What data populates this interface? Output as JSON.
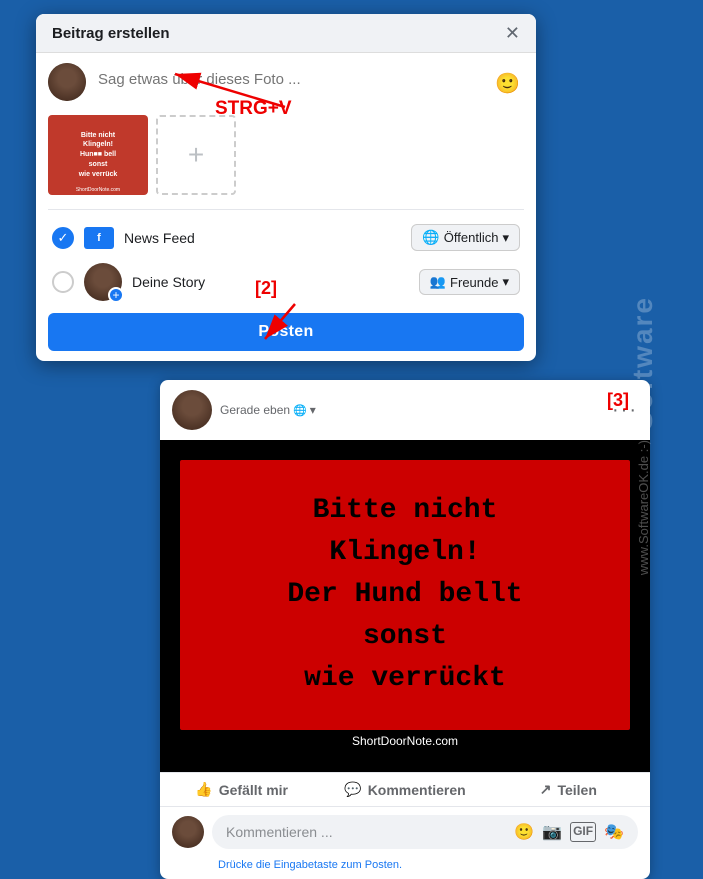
{
  "dialog": {
    "title": "Beitrag erstellen",
    "close_label": "✕",
    "input_placeholder": "Sag etwas über dieses Foto ...",
    "strg_label": "STRG+V",
    "add_more_icon": "+",
    "emoji_icon": "🙂",
    "preview_text": "Bitte nicht\nKlingeln!\nHun■■■ bell\nsonst\nwie verrück",
    "preview_site": "ShortDoorNote.com",
    "news_feed_label": "News Feed",
    "news_feed_icon": "f",
    "offentlich_label": "Öffentlich",
    "deine_story_label": "Deine Story",
    "freunde_label": "Freunde",
    "posten_label": "Posten",
    "label_2": "[2]"
  },
  "post": {
    "time_label": "Gerade eben",
    "globe_icon": "🌐",
    "dropdown_icon": "▾",
    "more_icon": "···",
    "image_line1": "Bitte nicht",
    "image_line2": "Klingeln!",
    "image_line3": "Der Hund bellt",
    "image_line4": "sonst",
    "image_line5": "wie verrückt",
    "image_site": "ShortDoorNote.com",
    "action_like": "Gefällt mir",
    "action_comment": "Kommentieren",
    "action_share": "Teilen",
    "comment_placeholder": "Kommentieren ...",
    "comment_hint": "Drücke die Eingabetaste zum Posten.",
    "label_3": "[3]"
  },
  "watermark": {
    "text": "Software",
    "site": "www.SoftwareOK.de :-)"
  }
}
